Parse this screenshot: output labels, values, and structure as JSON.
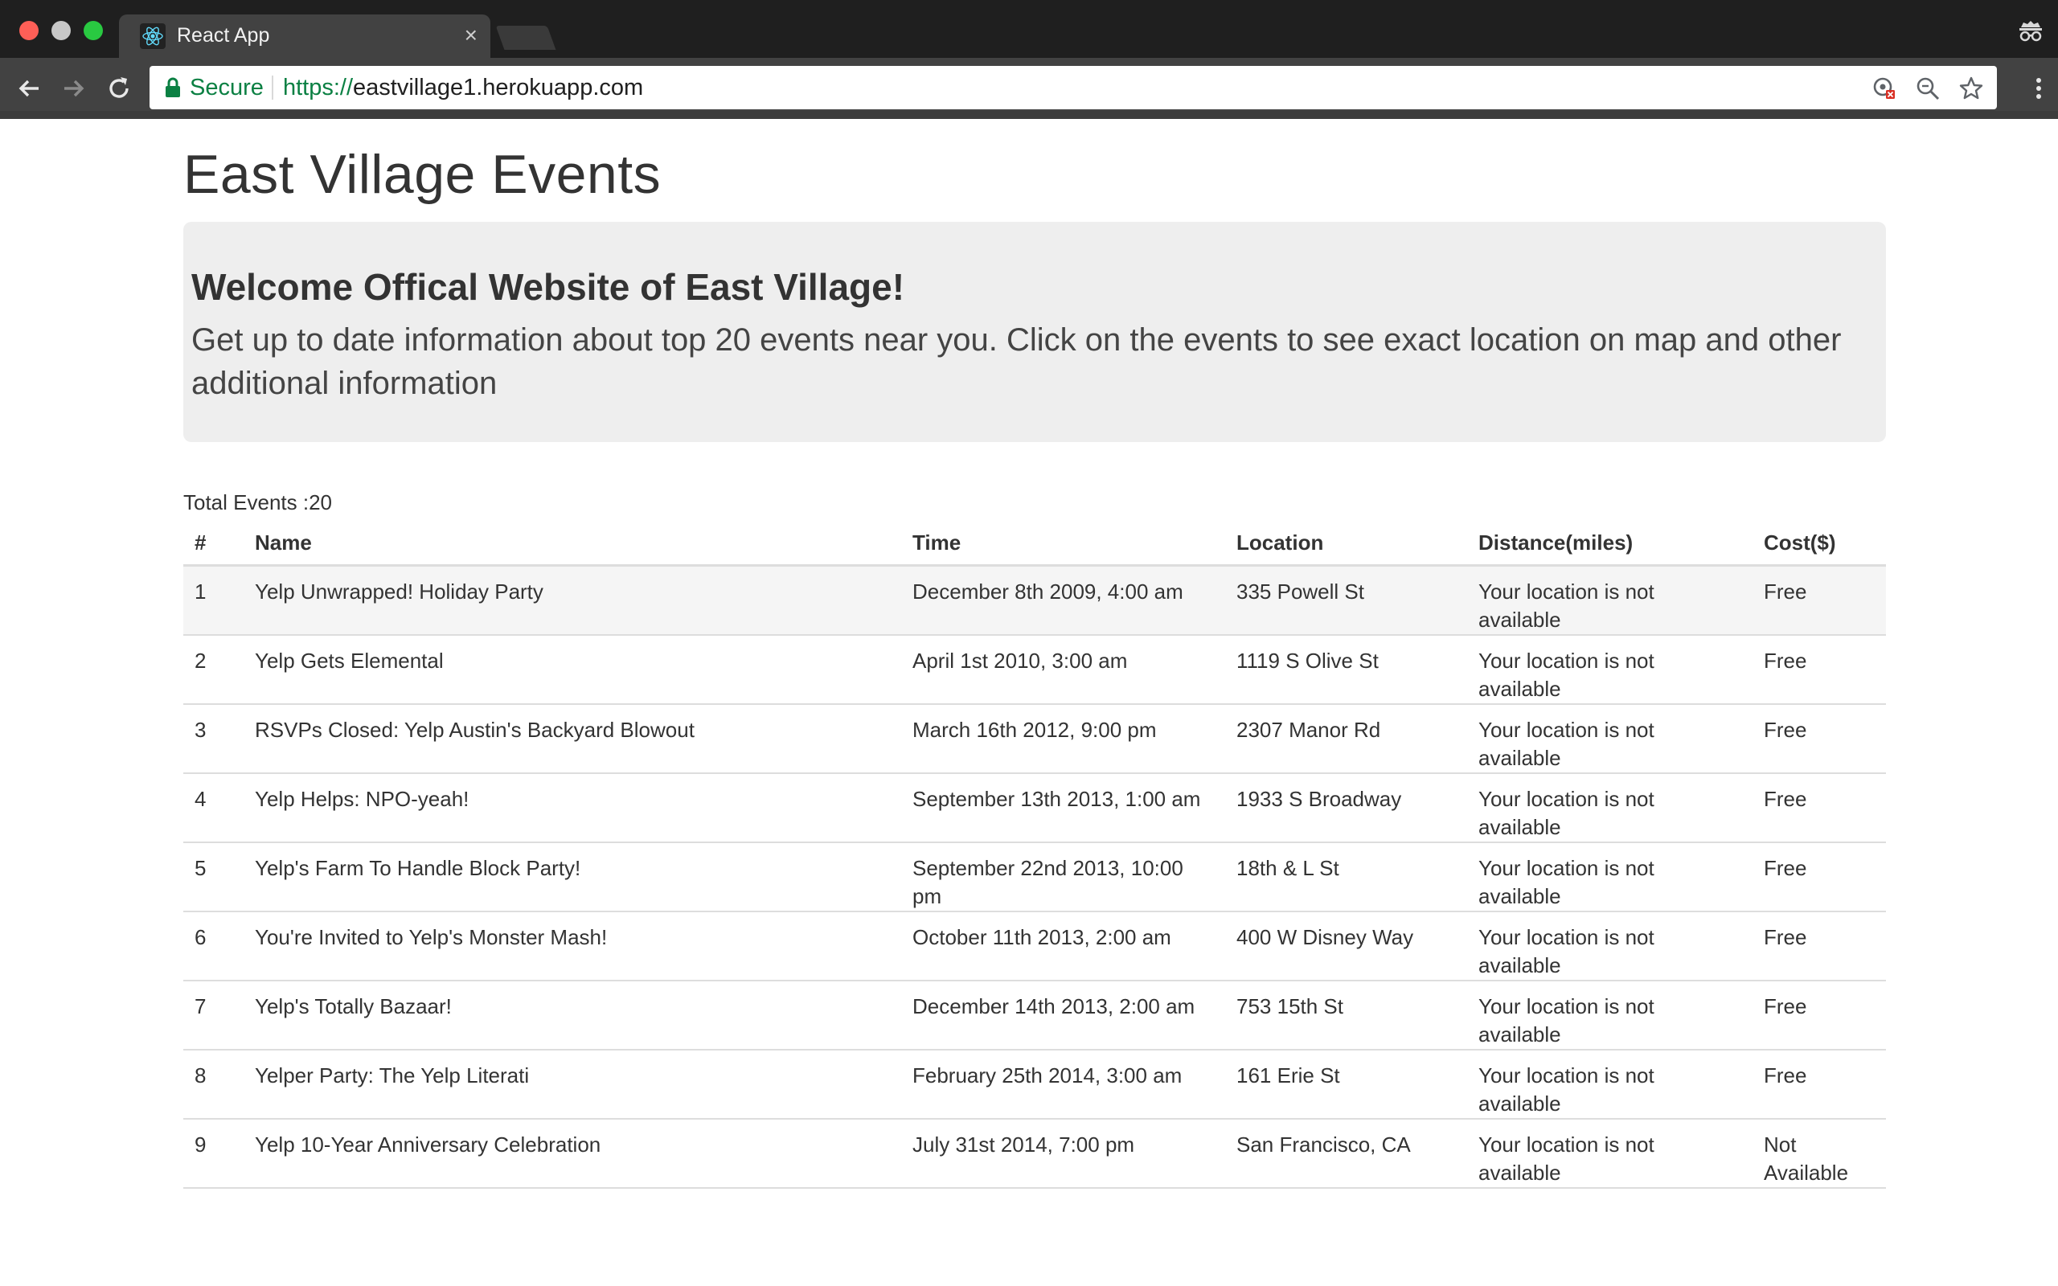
{
  "browser": {
    "tab_title": "React App",
    "tab_close": "×",
    "secure_label": "Secure",
    "url_scheme": "https://",
    "url_host": "eastvillage1.herokuapp.com"
  },
  "page": {
    "title": "East Village Events",
    "jumbotron": {
      "heading": "Welcome Offical Website of East Village!",
      "text": "Get up to date information about top 20 events near you. Click on the events to see exact location on map and other additional information"
    },
    "total_events": "Total Events :20"
  },
  "table": {
    "headers": [
      "#",
      "Name",
      "Time",
      "Location",
      "Distance(miles)",
      "Cost($)"
    ],
    "rows": [
      {
        "num": "1",
        "name": "Yelp Unwrapped! Holiday Party",
        "time": "December 8th 2009, 4:00 am",
        "location": "335 Powell St",
        "distance": "Your location is not available",
        "cost": "Free"
      },
      {
        "num": "2",
        "name": "Yelp Gets Elemental",
        "time": "April 1st 2010, 3:00 am",
        "location": "1119 S Olive St",
        "distance": "Your location is not available",
        "cost": "Free"
      },
      {
        "num": "3",
        "name": "RSVPs Closed: Yelp Austin's Backyard Blowout",
        "time": "March 16th 2012, 9:00 pm",
        "location": "2307 Manor Rd",
        "distance": "Your location is not available",
        "cost": "Free"
      },
      {
        "num": "4",
        "name": "Yelp Helps: NPO-yeah!",
        "time": "September 13th 2013, 1:00 am",
        "location": "1933 S Broadway",
        "distance": "Your location is not available",
        "cost": "Free"
      },
      {
        "num": "5",
        "name": "Yelp's Farm To Handle Block Party!",
        "time": "September 22nd 2013, 10:00 pm",
        "location": "18th & L St",
        "distance": "Your location is not available",
        "cost": "Free"
      },
      {
        "num": "6",
        "name": "You're Invited to Yelp's Monster Mash!",
        "time": "October 11th 2013, 2:00 am",
        "location": "400 W Disney Way",
        "distance": "Your location is not available",
        "cost": "Free"
      },
      {
        "num": "7",
        "name": "Yelp's Totally Bazaar!",
        "time": "December 14th 2013, 2:00 am",
        "location": "753 15th St",
        "distance": "Your location is not available",
        "cost": "Free"
      },
      {
        "num": "8",
        "name": "Yelper Party: The Yelp Literati",
        "time": "February 25th 2014, 3:00 am",
        "location": "161 Erie St",
        "distance": "Your location is not available",
        "cost": "Free"
      },
      {
        "num": "9",
        "name": "Yelp 10-Year Anniversary Celebration",
        "time": "July 31st 2014, 7:00 pm",
        "location": "San Francisco, CA",
        "distance": "Your location is not available",
        "cost": "Not Available"
      }
    ]
  },
  "icons": {
    "tab_favicon": "react-logo-icon",
    "incognito": "incognito-icon",
    "back": "back-arrow-icon",
    "forward": "forward-arrow-icon",
    "reload": "reload-icon",
    "lock": "lock-icon",
    "translate_blocked": "blocked-content-icon",
    "zoom": "zoom-icon",
    "bookmark": "star-icon",
    "menu": "more-vertical-icon"
  },
  "colors": {
    "secure_green": "#0b8043",
    "chrome_dark": "#1f1f1f",
    "chrome_toolbar": "#424242",
    "jumbotron_bg": "#eeeeee",
    "row_stripe": "#f5f5f5"
  }
}
